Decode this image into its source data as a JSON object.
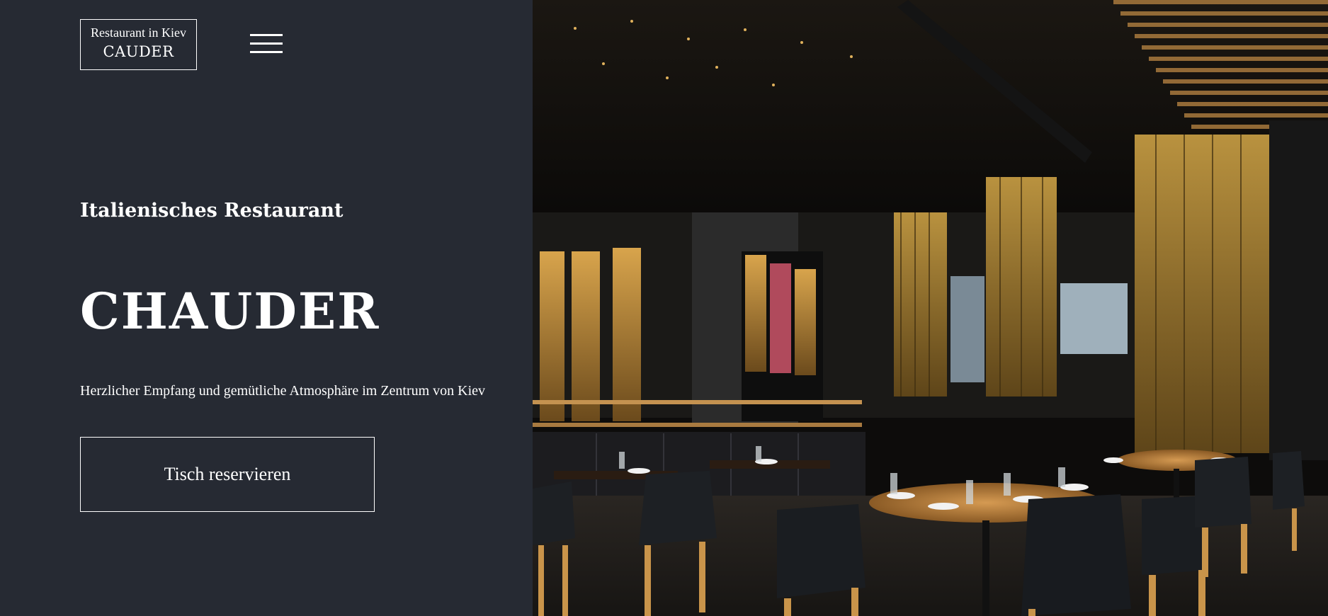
{
  "header": {
    "logo_subtitle": "Restaurant in Kiev",
    "logo_name": "CAUDER",
    "menu_icon": "hamburger-menu-icon"
  },
  "hero": {
    "subtitle": "Italienisches Restaurant",
    "title": "CHAUDER",
    "tagline": "Herzlicher Empfang und gemütliche Atmosphäre im Zentrum von Kiev",
    "cta_label": "Tisch reservieren"
  },
  "image": {
    "description": "restaurant-interior-photo"
  },
  "colors": {
    "panel_background": "#262a33",
    "text": "#ffffff",
    "accent_wood": "#c9944a"
  }
}
